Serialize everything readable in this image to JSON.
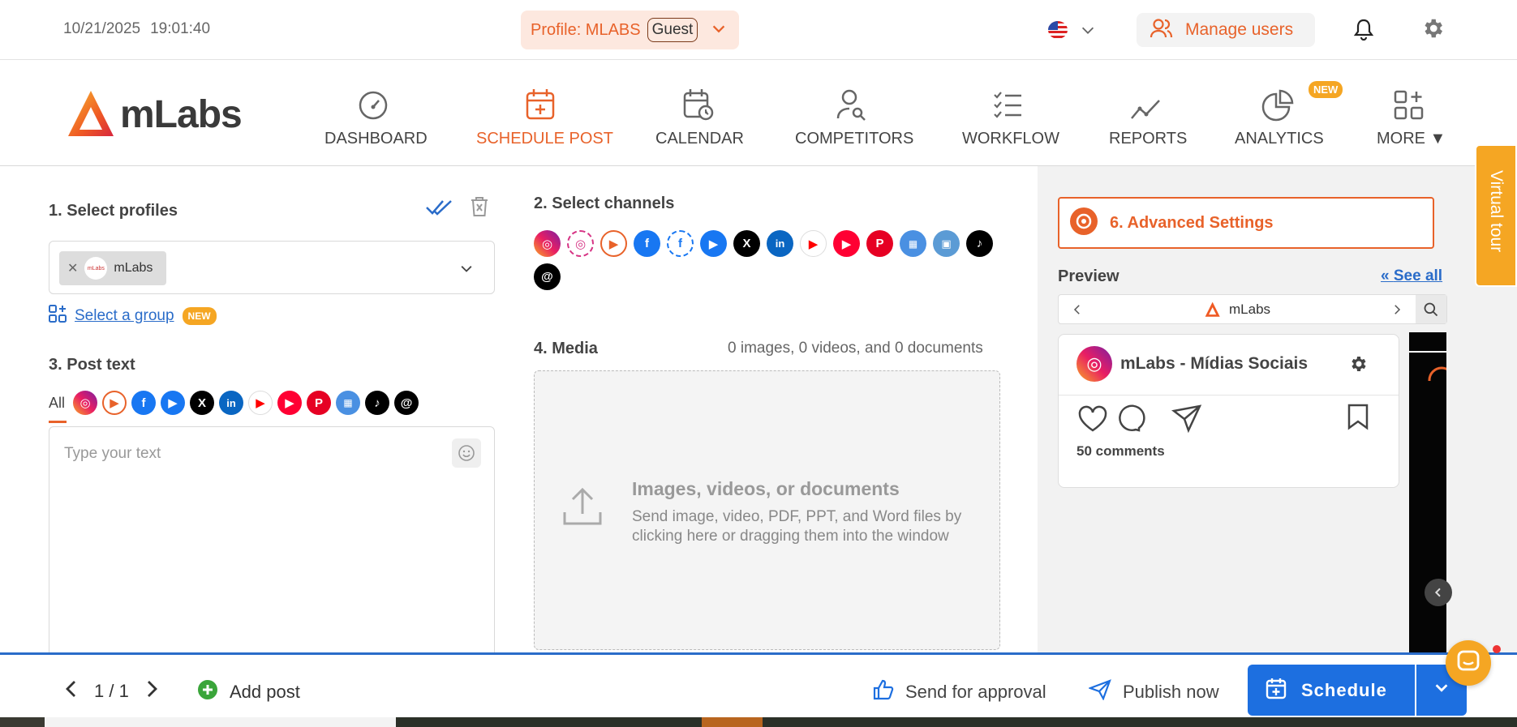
{
  "topbar": {
    "date": "10/21/2025",
    "time": "19:01:40",
    "profile_label": "Profile: MLABS",
    "guest_label": "Guest",
    "manage_users": "Manage users"
  },
  "nav": {
    "logo": "mLabs",
    "items": [
      {
        "label": "DASHBOARD"
      },
      {
        "label": "SCHEDULE POST"
      },
      {
        "label": "CALENDAR"
      },
      {
        "label": "COMPETITORS"
      },
      {
        "label": "WORKFLOW"
      },
      {
        "label": "REPORTS"
      },
      {
        "label": "ANALYTICS"
      },
      {
        "label": "MORE ▼"
      }
    ],
    "new_badge": "NEW"
  },
  "profiles": {
    "title": "1. Select profiles",
    "chip_label": "mLabs",
    "avatar_text": "mLabs",
    "group_link": "Select a group",
    "group_badge": "NEW"
  },
  "post_text": {
    "title": "3. Post text",
    "all_tab": "All",
    "placeholder": "Type your text"
  },
  "channels": {
    "title": "2. Select channels",
    "icons": [
      "instagram-icon",
      "instagram-outline-icon",
      "instagram-reels-icon",
      "facebook-icon",
      "facebook-outline-icon",
      "facebook-stories-icon",
      "x-icon",
      "linkedin-icon",
      "youtube-icon",
      "youtube-shorts-icon",
      "pinterest-icon",
      "google-business-icon",
      "image-icon",
      "tiktok-icon",
      "threads-icon"
    ]
  },
  "media": {
    "title": "4. Media",
    "count": "0 images, 0 videos, and 0 documents",
    "drop_title": "Images, videos, or documents",
    "drop_sub": "Send image, video, PDF, PPT, and Word files by clicking here or dragging them into the window"
  },
  "preview": {
    "advanced": "6. Advanced Settings",
    "title": "Preview",
    "see_all": "See all",
    "nav_profile": "mLabs",
    "card_name": "mLabs - Mídias Sociais",
    "comments": "50 comments"
  },
  "virtual_tour": "Virtual tour",
  "bottom": {
    "pager": "1 / 1",
    "add_post": "Add post",
    "approval": "Send for approval",
    "publish": "Publish now",
    "schedule": "Schedule"
  },
  "colors": {
    "accent": "#e8622a",
    "primary": "#1d6fe0",
    "badge": "#f5a623"
  }
}
